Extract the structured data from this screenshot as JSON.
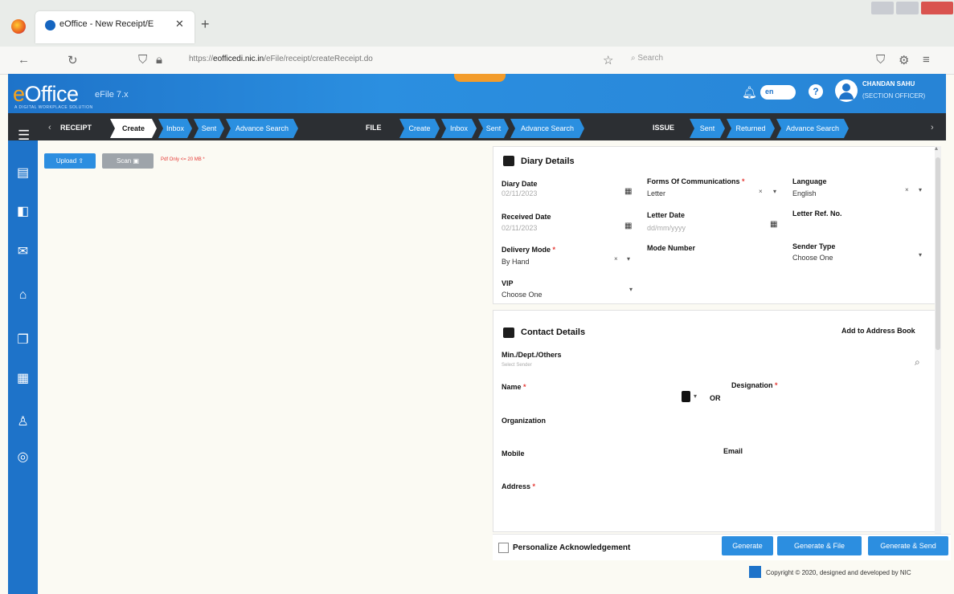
{
  "browser": {
    "tab_title": "eOffice - New Receipt/E",
    "url_prefix": "https://",
    "url_domain": "eofficedi.nic.in",
    "url_suffix": "/eFile/receipt/createReceipt.do",
    "search_placeholder": "Search"
  },
  "header": {
    "logo_e": "e",
    "logo_rest": "Office",
    "product": "eFile 7.x",
    "tagline": "A DIGITAL WORKPLACE SOLUTION",
    "lang": "en",
    "user_name": "CHANDAN SAHU",
    "user_role": "(SECTION OFFICER)"
  },
  "menubar": {
    "receipt_label": "RECEIPT",
    "receipt_items": [
      "Create",
      "Inbox",
      "Sent",
      "Advance Search"
    ],
    "file_label": "FILE",
    "file_items": [
      "Create",
      "Inbox",
      "Sent",
      "Advance Search"
    ],
    "issue_label": "ISSUE",
    "issue_items": [
      "Sent",
      "Returned",
      "Advance Search"
    ]
  },
  "toolbar": {
    "upload_label": "Upload",
    "scan_label": "Scan",
    "hint": "Pdf Only <= 20 MB *"
  },
  "diary": {
    "title": "Diary Details",
    "diary_date_label": "Diary Date",
    "diary_date_value": "02/11/2023",
    "forms_label": "Forms Of Communications",
    "forms_value": "Letter",
    "language_label": "Language",
    "language_value": "English",
    "received_date_label": "Received Date",
    "received_date_value": "02/11/2023",
    "letter_date_label": "Letter Date",
    "letter_date_placeholder": "dd/mm/yyyy",
    "letter_ref_label": "Letter Ref. No.",
    "delivery_mode_label": "Delivery Mode",
    "delivery_mode_value": "By Hand",
    "mode_number_label": "Mode Number",
    "sender_type_label": "Sender Type",
    "sender_type_value": "Choose One",
    "vip_label": "VIP",
    "vip_value": "Choose One"
  },
  "contact": {
    "title": "Contact Details",
    "add_address_book": "Add to Address Book",
    "min_dept_label": "Min./Dept./Others",
    "min_dept_placeholder": "Select Sender",
    "name_label": "Name",
    "or_label": "OR",
    "designation_label": "Designation",
    "organization_label": "Organization",
    "mobile_label": "Mobile",
    "email_label": "Email",
    "address_label": "Address"
  },
  "footer": {
    "personalize_label": "Personalize Acknowledgement",
    "generate_label": "Generate",
    "generate_file_label": "Generate & File",
    "generate_send_label": "Generate & Send",
    "copyright": "Copyright © 2020, designed and developed by NIC"
  },
  "colors": {
    "header_blue": "#2784d6",
    "menu_dark": "#2c2f33",
    "button_blue": "#2c8ee0",
    "accent_orange": "#f7a31c",
    "required_red": "#e53935"
  }
}
